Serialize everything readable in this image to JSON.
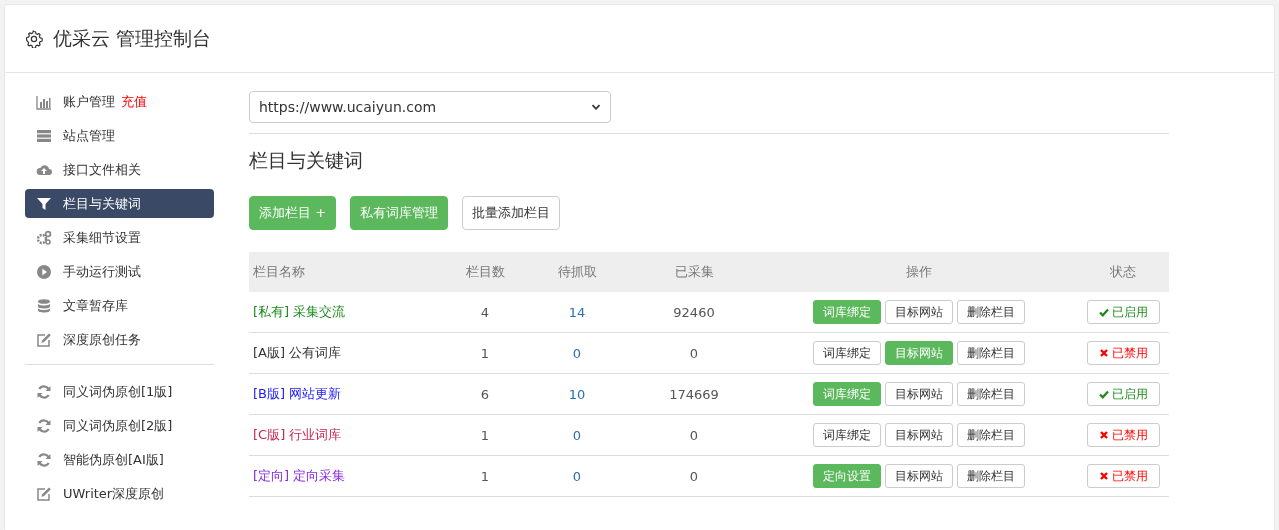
{
  "header": {
    "title": "优采云 管理控制台"
  },
  "sidebar": {
    "groups": [
      [
        {
          "kind": "chart",
          "label": "账户管理",
          "badge": "充值",
          "selected": false
        },
        {
          "kind": "server",
          "label": "站点管理",
          "selected": false
        },
        {
          "kind": "cloud",
          "label": "接口文件相关",
          "selected": false
        },
        {
          "kind": "filter",
          "label": "栏目与关键词",
          "selected": true
        },
        {
          "kind": "gears",
          "label": "采集细节设置",
          "selected": false
        },
        {
          "kind": "play",
          "label": "手动运行测试",
          "selected": false
        },
        {
          "kind": "database",
          "label": "文章暂存库",
          "selected": false
        },
        {
          "kind": "edit",
          "label": "深度原创任务",
          "selected": false
        }
      ],
      [
        {
          "kind": "refresh",
          "label": "同义词伪原创[1版]",
          "selected": false
        },
        {
          "kind": "refresh",
          "label": "同义词伪原创[2版]",
          "selected": false
        },
        {
          "kind": "refresh",
          "label": "智能伪原创[AI版]",
          "selected": false
        },
        {
          "kind": "edit",
          "label": "UWriter深度原创",
          "selected": false
        }
      ]
    ]
  },
  "site_select": {
    "value": "https://www.ucaiyun.com"
  },
  "section_title": "栏目与关键词",
  "toolbar": [
    {
      "label": "添加栏目 +",
      "primary": true
    },
    {
      "label": "私有词库管理",
      "primary": true
    },
    {
      "label": "批量添加栏目",
      "primary": false
    }
  ],
  "table": {
    "columns": [
      "栏目名称",
      "栏目数",
      "待抓取",
      "已采集",
      "操作",
      "状态"
    ],
    "rows": [
      {
        "name": "[私有] 采集交流",
        "color": "#1a8a1a",
        "count": "4",
        "pending": "14",
        "collected": "92460",
        "actions": [
          {
            "label": "词库绑定",
            "active": true
          },
          {
            "label": "目标网站",
            "active": false
          },
          {
            "label": "删除栏目",
            "active": false
          }
        ],
        "status": "已启用",
        "enabled": true
      },
      {
        "name": "[A版] 公有词库",
        "color": "#333333",
        "count": "1",
        "pending": "0",
        "collected": "0",
        "actions": [
          {
            "label": "词库绑定",
            "active": false
          },
          {
            "label": "目标网站",
            "active": true
          },
          {
            "label": "删除栏目",
            "active": false
          }
        ],
        "status": "已禁用",
        "enabled": false
      },
      {
        "name": "[B版] 网站更新",
        "color": "#1a1aff",
        "count": "6",
        "pending": "10",
        "collected": "174669",
        "actions": [
          {
            "label": "词库绑定",
            "active": true
          },
          {
            "label": "目标网站",
            "active": false
          },
          {
            "label": "删除栏目",
            "active": false
          }
        ],
        "status": "已启用",
        "enabled": true
      },
      {
        "name": "[C版] 行业词库",
        "color": "#c7254e",
        "count": "1",
        "pending": "0",
        "collected": "0",
        "actions": [
          {
            "label": "词库绑定",
            "active": false
          },
          {
            "label": "目标网站",
            "active": false
          },
          {
            "label": "删除栏目",
            "active": false
          }
        ],
        "status": "已禁用",
        "enabled": false
      },
      {
        "name": "[定向] 定向采集",
        "color": "#8a2be2",
        "count": "1",
        "pending": "0",
        "collected": "0",
        "actions": [
          {
            "label": "定向设置",
            "active": true
          },
          {
            "label": "目标网站",
            "active": false
          },
          {
            "label": "删除栏目",
            "active": false
          }
        ],
        "status": "已禁用",
        "enabled": false
      }
    ]
  }
}
